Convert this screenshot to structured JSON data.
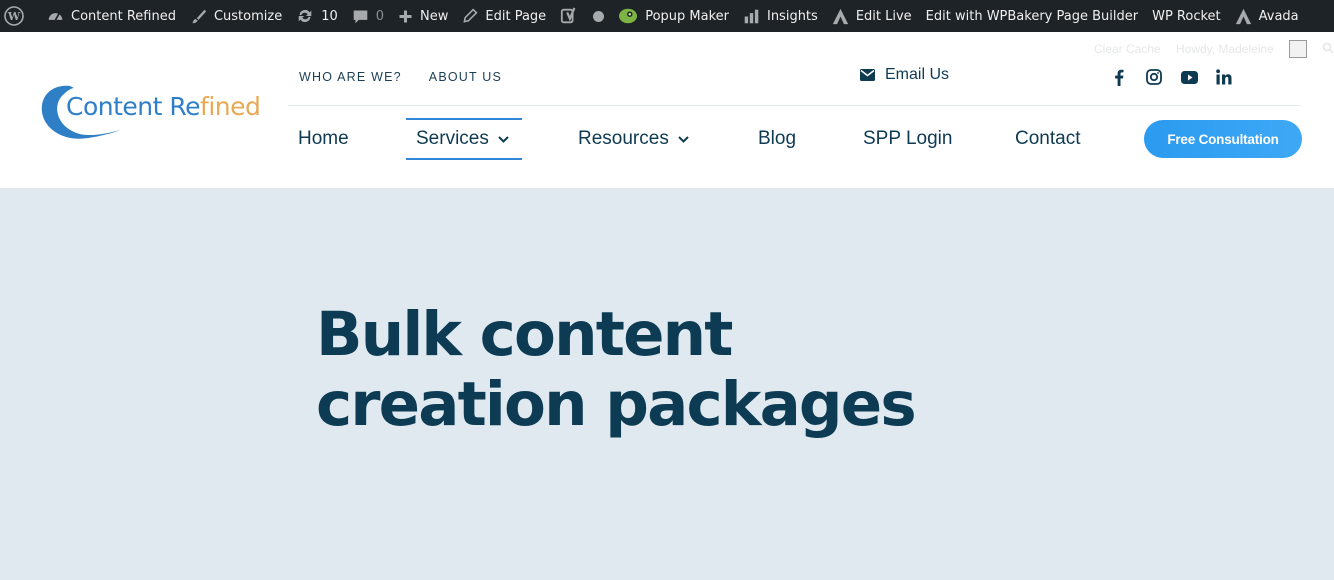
{
  "adminbar": {
    "items": [
      {
        "icon": "wordpress-logo-icon",
        "label": ""
      },
      {
        "icon": "dashboard-icon",
        "label": "Content Refined"
      },
      {
        "icon": "paintbrush-icon",
        "label": "Customize"
      },
      {
        "icon": "updates-icon",
        "label": "10"
      },
      {
        "icon": "comment-icon",
        "label": "0"
      },
      {
        "icon": "plus-icon",
        "label": "New"
      },
      {
        "icon": "pencil-icon",
        "label": "Edit Page"
      },
      {
        "icon": "yoast-icon",
        "label": ""
      },
      {
        "icon": "popup-maker-icon",
        "label": "Popup Maker"
      },
      {
        "icon": "bar-chart-icon",
        "label": "Insights"
      },
      {
        "icon": "avada-icon",
        "label": "Edit Live"
      },
      {
        "icon": "",
        "label": "Edit with WPBakery Page Builder"
      },
      {
        "icon": "",
        "label": "WP Rocket"
      },
      {
        "icon": "avada-icon",
        "label": "Avada"
      }
    ],
    "clear_cache": "Clear Cache",
    "howdy": "Howdy, Madeleine"
  },
  "logo": {
    "part1": "Content Re",
    "part2": "fined"
  },
  "topnav": {
    "who": "WHO ARE WE?",
    "about": "ABOUT US"
  },
  "contact": {
    "email_label": "Email Us"
  },
  "social": [
    "facebook-icon",
    "instagram-icon",
    "youtube-icon",
    "linkedin-icon"
  ],
  "nav": {
    "home": "Home",
    "services": "Services",
    "resources": "Resources",
    "blog": "Blog",
    "spp": "SPP Login",
    "contact": "Contact"
  },
  "cta": "Free Consultation",
  "hero": {
    "title": "Bulk content creation packages"
  },
  "colors": {
    "adminbar": "#1d2327",
    "brand_blue": "#2f86d7",
    "navy": "#0c3b53",
    "hero_bg": "#dfe9ef"
  }
}
